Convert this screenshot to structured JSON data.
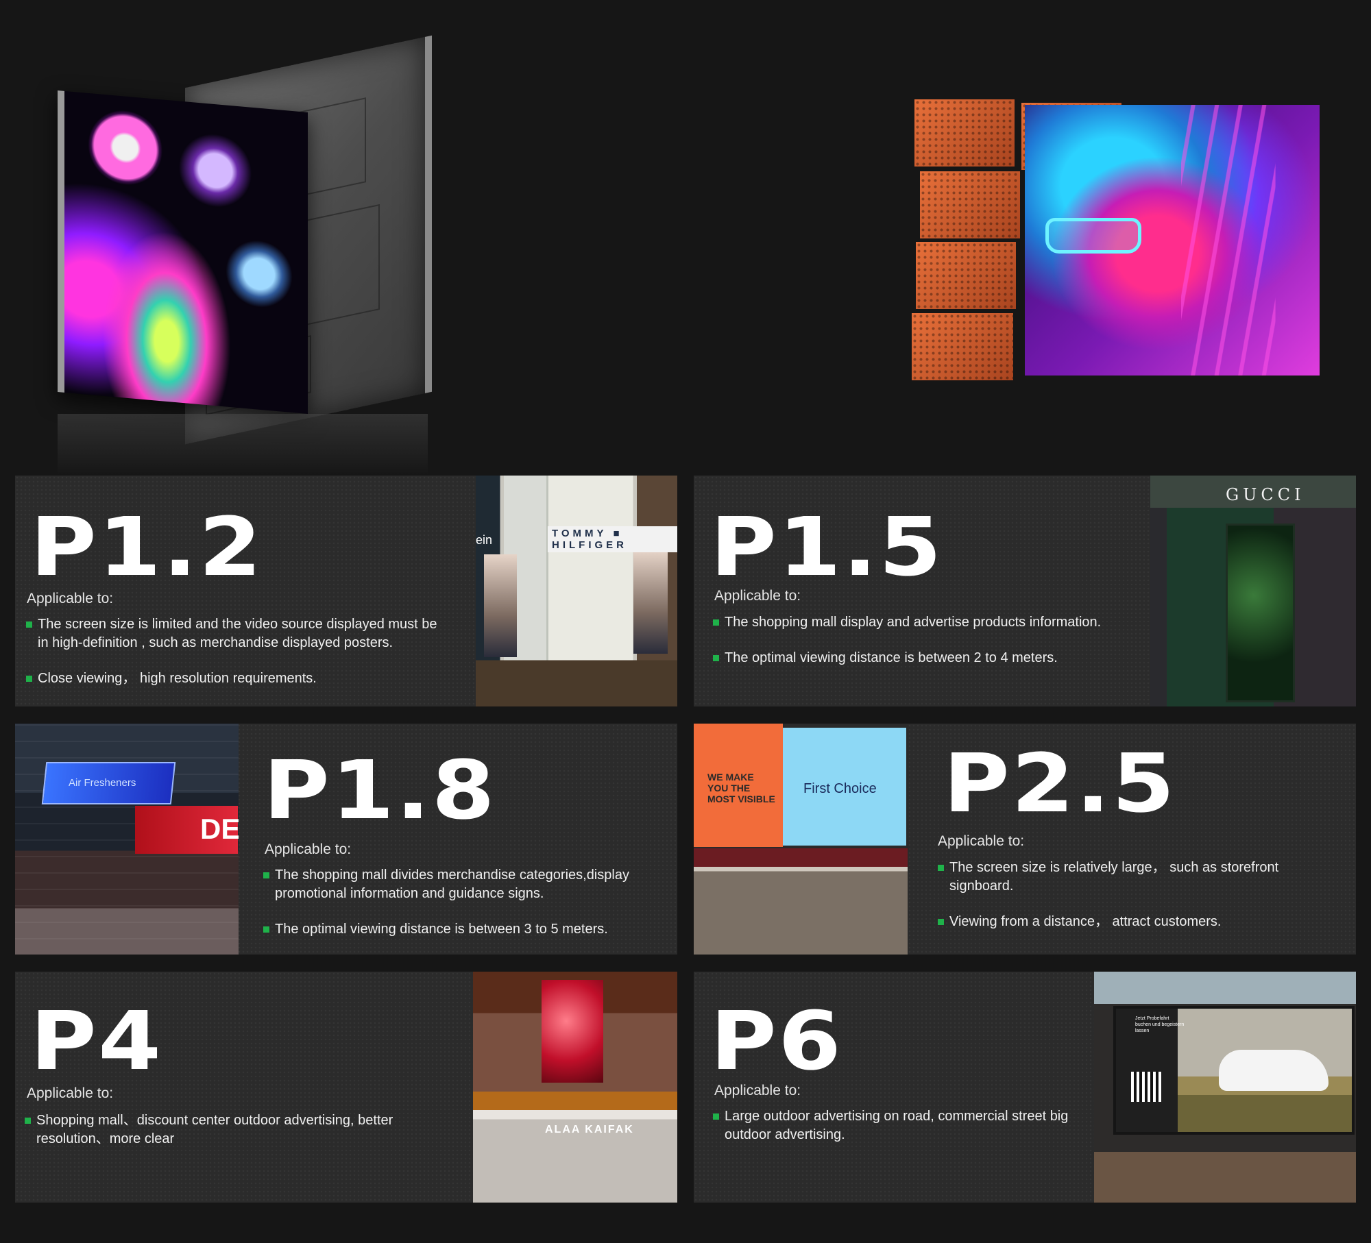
{
  "colors": {
    "background": "#161616",
    "card": "#2b2b2b",
    "bullet": "#1fb24a",
    "text": "#ffffff"
  },
  "hero": {
    "left_image": "led-cabinet-module",
    "right_image": "neon-portrait-tile-collage"
  },
  "cards": [
    {
      "title": "P1.2",
      "subtitle": "Applicable to:",
      "bullets": [
        "The screen size is limited and the video source displayed must be in high-definition , such as merchandise displayed posters.",
        "Close viewing，  high resolution requirements."
      ],
      "photo": {
        "sign": "TOMMY ■ HILFIGER",
        "side": "ein"
      }
    },
    {
      "title": "P1.5",
      "subtitle": "Applicable to:",
      "bullets": [
        "The shopping mall display and advertise products information.",
        "The optimal viewing distance is between 2 to 4 meters."
      ],
      "photo": {
        "sign": "GUCCI"
      }
    },
    {
      "title": "P1.8",
      "subtitle": "Applicable to:",
      "bullets": [
        "The shopping mall divides merchandise categories,display promotional information and guidance signs.",
        "The optimal viewing distance is between 3 to 5 meters."
      ],
      "photo": {
        "screen_text": "Air Fresheners",
        "sign": "DE"
      }
    },
    {
      "title": "P2.5",
      "subtitle": "Applicable to:",
      "bullets": [
        "The screen size is relatively large，  such as storefront signboard.",
        "Viewing from a distance，  attract customers."
      ],
      "photo": {
        "left_text": "WE MAKE YOU THE MOST VISIBLE",
        "right_text": "First Choice"
      }
    },
    {
      "title": "P4",
      "subtitle": "Applicable to:",
      "bullets": [
        "Shopping mall、discount center outdoor advertising, better resolution、more clear"
      ],
      "photo": {
        "sign": "ALAA KAIFAK"
      }
    },
    {
      "title": "P6",
      "subtitle": "Applicable to:",
      "bullets": [
        "Large outdoor advertising on road, commercial street big outdoor advertising."
      ],
      "photo": {
        "billboard_text": "Jetzt Probefahrt buchen und begeistern lassen"
      }
    }
  ]
}
